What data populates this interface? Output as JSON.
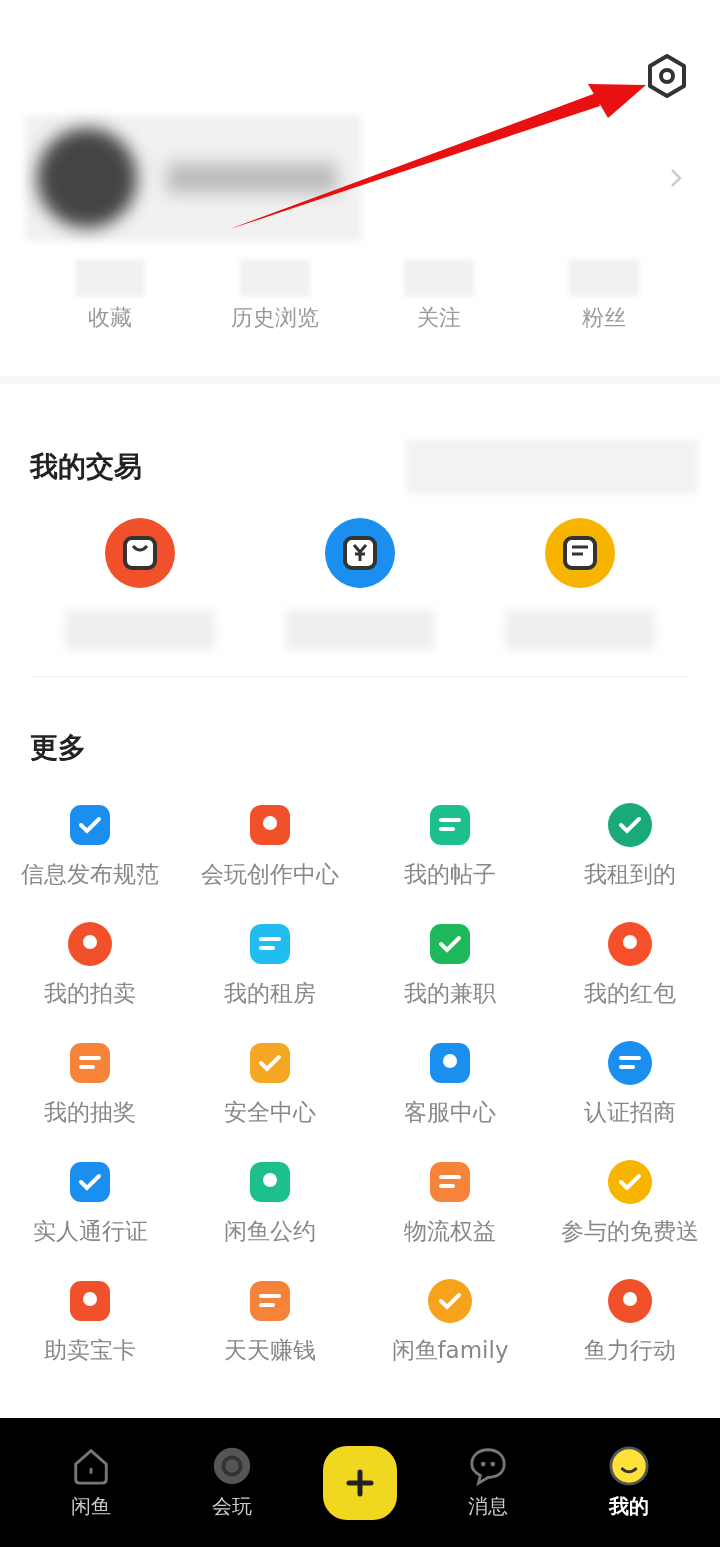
{
  "profile": {
    "stats": [
      {
        "label": "收藏"
      },
      {
        "label": "历史浏览"
      },
      {
        "label": "关注"
      },
      {
        "label": "粉丝"
      }
    ]
  },
  "trades": {
    "title": "我的交易",
    "items": [
      {
        "color": "#f0512a"
      },
      {
        "color": "#1a8ff0"
      },
      {
        "color": "#f7b500"
      }
    ]
  },
  "more": {
    "title": "更多",
    "items": [
      {
        "label": "信息发布规范",
        "color": "#1a8ff0"
      },
      {
        "label": "会玩创作中心",
        "color": "#f0512a"
      },
      {
        "label": "我的帖子",
        "color": "#1dc08c"
      },
      {
        "label": "我租到的",
        "color": "#1aa97a"
      },
      {
        "label": "我的拍卖",
        "color": "#f0512a"
      },
      {
        "label": "我的租房",
        "color": "#22bdf0"
      },
      {
        "label": "我的兼职",
        "color": "#1cb85a"
      },
      {
        "label": "我的红包",
        "color": "#f5502a"
      },
      {
        "label": "我的抽奖",
        "color": "#f5843a"
      },
      {
        "label": "安全中心",
        "color": "#f5a623"
      },
      {
        "label": "客服中心",
        "color": "#1a8ff0"
      },
      {
        "label": "认证招商",
        "color": "#1a8ff0"
      },
      {
        "label": "实人通行证",
        "color": "#1a8ff0"
      },
      {
        "label": "闲鱼公约",
        "color": "#1dc08c"
      },
      {
        "label": "物流权益",
        "color": "#f5843a"
      },
      {
        "label": "参与的免费送",
        "color": "#f7b500"
      },
      {
        "label": "助卖宝卡",
        "color": "#f0512a"
      },
      {
        "label": "天天赚钱",
        "color": "#f5843a"
      },
      {
        "label": "闲鱼family",
        "color": "#f7a21b"
      },
      {
        "label": "鱼力行动",
        "color": "#f0512a"
      }
    ]
  },
  "tabs": [
    {
      "label": "闲鱼",
      "selected": false
    },
    {
      "label": "会玩",
      "selected": false
    },
    {
      "kind": "post",
      "selected": false
    },
    {
      "label": "消息",
      "selected": false
    },
    {
      "label": "我的",
      "selected": true
    }
  ]
}
